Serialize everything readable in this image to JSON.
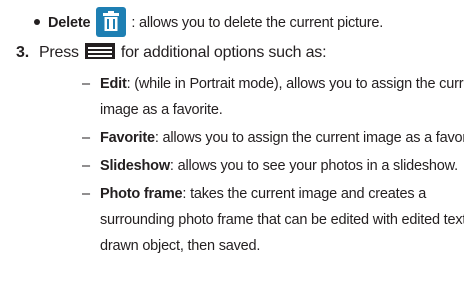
{
  "bullet": {
    "term": "Delete",
    "text": ": allows you to delete the current picture."
  },
  "step3": {
    "number": "3.",
    "text_before": "Press",
    "text_after": "for additional options such as:"
  },
  "options": [
    {
      "term": "Edit",
      "text": ": (while in Portrait mode), allows you to assign the current"
    },
    {
      "term": "Favorite",
      "text": ": allows you to assign the current image as a favorite."
    },
    {
      "term": "Slideshow",
      "text": ": allows you to see your photos in a slideshow."
    },
    {
      "term": "Photo frame",
      "text": ": takes the current image and creates a"
    }
  ],
  "continuations": {
    "edit": "image as a favorite.",
    "photo_frame_1": "surrounding photo frame that can be edited with edited text or",
    "photo_frame_2": "drawn object, then saved."
  },
  "dash_char": "–",
  "icons": {
    "delete": "trash-icon",
    "menu": "menu-icon"
  },
  "colors": {
    "text": "#231f20",
    "icon_blue": "#1e7fb3",
    "icon_white": "#ffffff"
  }
}
